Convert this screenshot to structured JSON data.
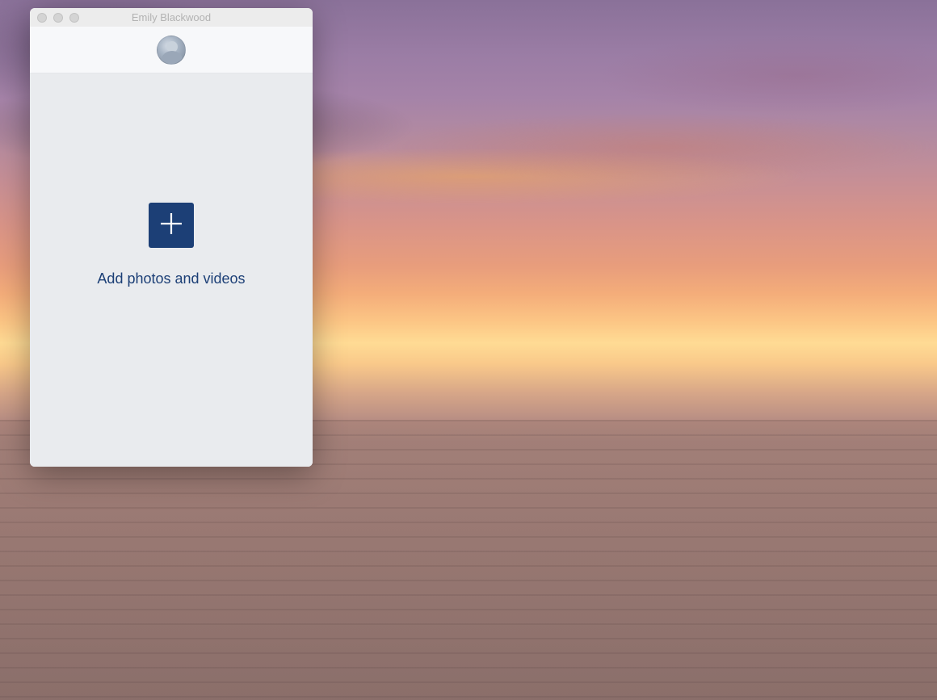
{
  "window": {
    "title": "Emily Blackwood"
  },
  "content": {
    "add_label": "Add photos and videos"
  },
  "colors": {
    "accent": "#1c3f76"
  }
}
